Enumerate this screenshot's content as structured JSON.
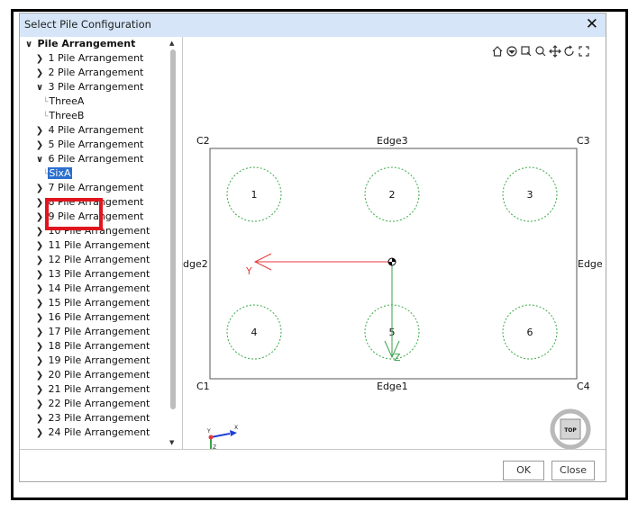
{
  "window": {
    "title": "Select Pile Configuration"
  },
  "tree": {
    "root": "Pile Arrangement",
    "items": [
      {
        "label": "1 Pile Arrangement"
      },
      {
        "label": "2 Pile Arrangement"
      },
      {
        "label": "3 Pile Arrangement",
        "children": [
          "ThreeA",
          "ThreeB"
        ]
      },
      {
        "label": "4 Pile Arrangement"
      },
      {
        "label": "5 Pile Arrangement"
      },
      {
        "label": "6 Pile Arrangement",
        "children": [
          "SixA"
        ]
      },
      {
        "label": "7 Pile Arrangement"
      },
      {
        "label": "8 Pile Arrangement"
      },
      {
        "label": "9 Pile Arrangement"
      },
      {
        "label": "10 Pile Arrangement"
      },
      {
        "label": "11 Pile Arrangement"
      },
      {
        "label": "12 Pile Arrangement"
      },
      {
        "label": "13 Pile Arrangement"
      },
      {
        "label": "14 Pile Arrangement"
      },
      {
        "label": "15 Pile Arrangement"
      },
      {
        "label": "16 Pile Arrangement"
      },
      {
        "label": "17 Pile Arrangement"
      },
      {
        "label": "18 Pile Arrangement"
      },
      {
        "label": "19 Pile Arrangement"
      },
      {
        "label": "20 Pile Arrangement"
      },
      {
        "label": "21 Pile Arrangement"
      },
      {
        "label": "22 Pile Arrangement"
      },
      {
        "label": "23 Pile Arrangement"
      },
      {
        "label": "24 Pile Arrangement"
      }
    ],
    "selected": "SixA"
  },
  "viewport": {
    "toolbar_icons": [
      "home-icon",
      "view-cube-icon",
      "zoom-extents-icon",
      "zoom-icon",
      "pan-icon",
      "rotate-icon",
      "fit-icon"
    ],
    "corners": {
      "c1": "C1",
      "c2": "C2",
      "c3": "C3",
      "c4": "C4"
    },
    "edges": {
      "edge1": "Edge1",
      "edge2": "dge2",
      "edge3": "Edge3",
      "edge4": "Edge"
    },
    "piles": [
      "1",
      "2",
      "3",
      "4",
      "5",
      "6"
    ],
    "axes": {
      "y": "Y",
      "z": "Z"
    },
    "triad": {
      "x": "X",
      "y": "Y",
      "z": "Z"
    },
    "view_badge": "TOP",
    "colors": {
      "pile_outline": "#3aaa48",
      "y_axis": "#e8393c",
      "z_axis": "#3aa04a",
      "triad_x": "#1f3fd8"
    }
  },
  "buttons": {
    "ok": "OK",
    "close": "Close"
  }
}
